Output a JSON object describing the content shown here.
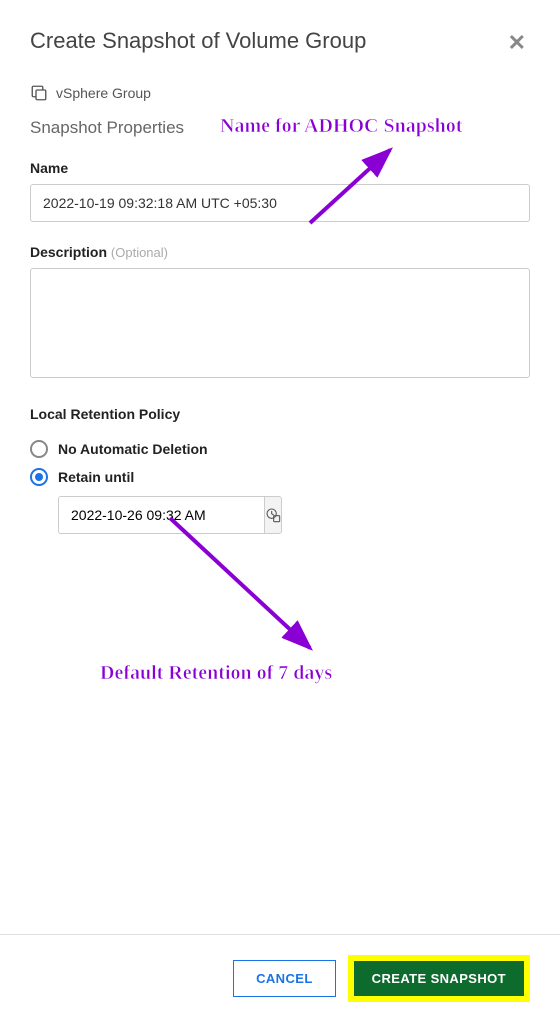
{
  "dialog": {
    "title": "Create Snapshot of Volume Group",
    "groupName": "vSphere Group",
    "sectionHeader": "Snapshot Properties"
  },
  "fields": {
    "nameLabel": "Name",
    "nameValue": "2022-10-19 09:32:18 AM UTC +05:30",
    "descriptionLabel": "Description",
    "descriptionOptional": "(Optional)",
    "descriptionValue": ""
  },
  "retention": {
    "sectionLabel": "Local Retention Policy",
    "options": [
      {
        "label": "No Automatic Deletion",
        "selected": false
      },
      {
        "label": "Retain until",
        "selected": true
      }
    ],
    "retainUntilValue": "2022-10-26 09:32 AM"
  },
  "footer": {
    "cancel": "CANCEL",
    "create": "CREATE SNAPSHOT"
  },
  "annotations": {
    "top": "Name for ADHOC Snapshot",
    "bottom": "Default Retention of 7 days"
  }
}
